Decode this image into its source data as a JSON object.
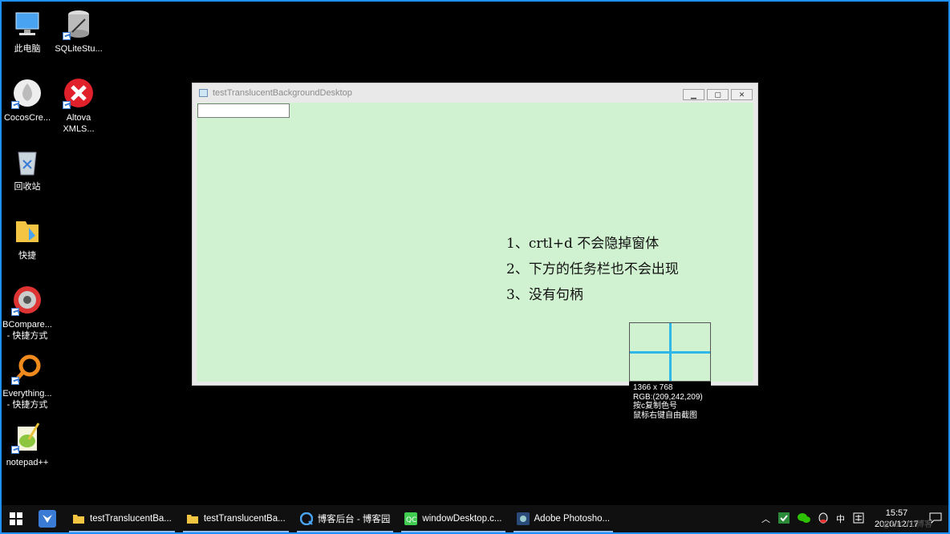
{
  "desktop": {
    "icons": [
      {
        "label": "此电脑"
      },
      {
        "label": "SQLiteStu..."
      },
      {
        "label": "CocosCre..."
      },
      {
        "label": "Altova XMLS..."
      },
      {
        "label": "回收站"
      },
      {
        "label": "快捷"
      },
      {
        "label": "BCompare... - 快捷方式"
      },
      {
        "label": "Everything... - 快捷方式"
      },
      {
        "label": "notepad++"
      }
    ]
  },
  "window": {
    "title": "testTranslucentBackgroundDesktop",
    "background": "#d1f2d1",
    "notes": [
      "1、crtl+d 不会隐掉窗体",
      "2、下方的任务栏也不会出现",
      "3、没有句柄"
    ]
  },
  "magnifier": {
    "resolution": "1366 x 768",
    "rgb": "RGB:(209,242,209)",
    "hint_copy": "按c复制色号",
    "hint_shot": "鼠标右键自由截图",
    "crosshair_color": "#2fb7e8"
  },
  "taskbar": {
    "items": [
      {
        "label": "testTranslucentBa...",
        "icon": "folder-icon"
      },
      {
        "label": "testTranslucentBa...",
        "icon": "folder-icon"
      },
      {
        "label": "博客后台 - 博客园",
        "icon": "browser-icon"
      },
      {
        "label": "windowDesktop.c...",
        "icon": "qt-creator-icon"
      },
      {
        "label": "Adobe Photosho...",
        "icon": "photoshop-icon"
      }
    ],
    "tray": {
      "ime": "中",
      "time": "15:57",
      "date": "2020/12/17"
    }
  },
  "watermark": "@51CTO博客"
}
